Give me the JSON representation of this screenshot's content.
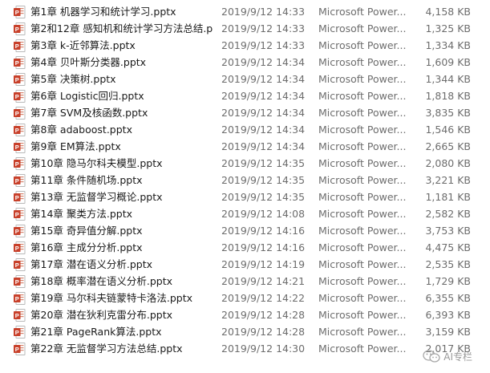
{
  "files": [
    {
      "name": "第1章 机器学习和统计学习.pptx",
      "date": "2019/9/12 14:33",
      "type": "Microsoft Power...",
      "size": "4,158 KB"
    },
    {
      "name": "第2和12章 感知机和统计学习方法总结.p...",
      "date": "2019/9/12 14:33",
      "type": "Microsoft Power...",
      "size": "1,325 KB"
    },
    {
      "name": "第3章 k-近邻算法.pptx",
      "date": "2019/9/12 14:33",
      "type": "Microsoft Power...",
      "size": "1,334 KB"
    },
    {
      "name": "第4章 贝叶斯分类器.pptx",
      "date": "2019/9/12 14:34",
      "type": "Microsoft Power...",
      "size": "1,609 KB"
    },
    {
      "name": "第5章 决策树.pptx",
      "date": "2019/9/12 14:34",
      "type": "Microsoft Power...",
      "size": "1,344 KB"
    },
    {
      "name": "第6章 Logistic回归.pptx",
      "date": "2019/9/12 14:34",
      "type": "Microsoft Power...",
      "size": "1,818 KB"
    },
    {
      "name": "第7章 SVM及核函数.pptx",
      "date": "2019/9/12 14:34",
      "type": "Microsoft Power...",
      "size": "3,835 KB"
    },
    {
      "name": "第8章 adaboost.pptx",
      "date": "2019/9/12 14:34",
      "type": "Microsoft Power...",
      "size": "1,546 KB"
    },
    {
      "name": "第9章 EM算法.pptx",
      "date": "2019/9/12 14:34",
      "type": "Microsoft Power...",
      "size": "2,665 KB"
    },
    {
      "name": "第10章 隐马尔科夫模型.pptx",
      "date": "2019/9/12 14:35",
      "type": "Microsoft Power...",
      "size": "2,080 KB"
    },
    {
      "name": "第11章 条件随机场.pptx",
      "date": "2019/9/12 14:35",
      "type": "Microsoft Power...",
      "size": "3,221 KB"
    },
    {
      "name": "第13章 无监督学习概论.pptx",
      "date": "2019/9/12 14:35",
      "type": "Microsoft Power...",
      "size": "1,181 KB"
    },
    {
      "name": "第14章 聚类方法.pptx",
      "date": "2019/9/12 14:08",
      "type": "Microsoft Power...",
      "size": "2,582 KB"
    },
    {
      "name": "第15章 奇异值分解.pptx",
      "date": "2019/9/12 14:16",
      "type": "Microsoft Power...",
      "size": "3,753 KB"
    },
    {
      "name": "第16章 主成分分析.pptx",
      "date": "2019/9/12 14:16",
      "type": "Microsoft Power...",
      "size": "4,475 KB"
    },
    {
      "name": "第17章 潜在语义分析.pptx",
      "date": "2019/9/12 14:19",
      "type": "Microsoft Power...",
      "size": "2,535 KB"
    },
    {
      "name": "第18章  概率潜在语义分析.pptx",
      "date": "2019/9/12 14:21",
      "type": "Microsoft Power...",
      "size": "1,729 KB"
    },
    {
      "name": "第19章  马尔科夫链蒙特卡洛法.pptx",
      "date": "2019/9/12 14:22",
      "type": "Microsoft Power...",
      "size": "6,355 KB"
    },
    {
      "name": "第20章  潜在狄利克雷分布.pptx",
      "date": "2019/9/12 14:28",
      "type": "Microsoft Power...",
      "size": "6,393 KB"
    },
    {
      "name": "第21章 PageRank算法.pptx",
      "date": "2019/9/12 14:28",
      "type": "Microsoft Power...",
      "size": "3,159 KB"
    },
    {
      "name": "第22章 无监督学习方法总结.pptx",
      "date": "2019/9/12 14:30",
      "type": "Microsoft Power...",
      "size": "2,017 KB"
    }
  ],
  "watermark": {
    "text": "AI专栏",
    "icon": "wechat-icon"
  },
  "colors": {
    "pptx_icon": "#c8402a",
    "text": "#1a1a1a",
    "meta": "#6d6d6d"
  }
}
